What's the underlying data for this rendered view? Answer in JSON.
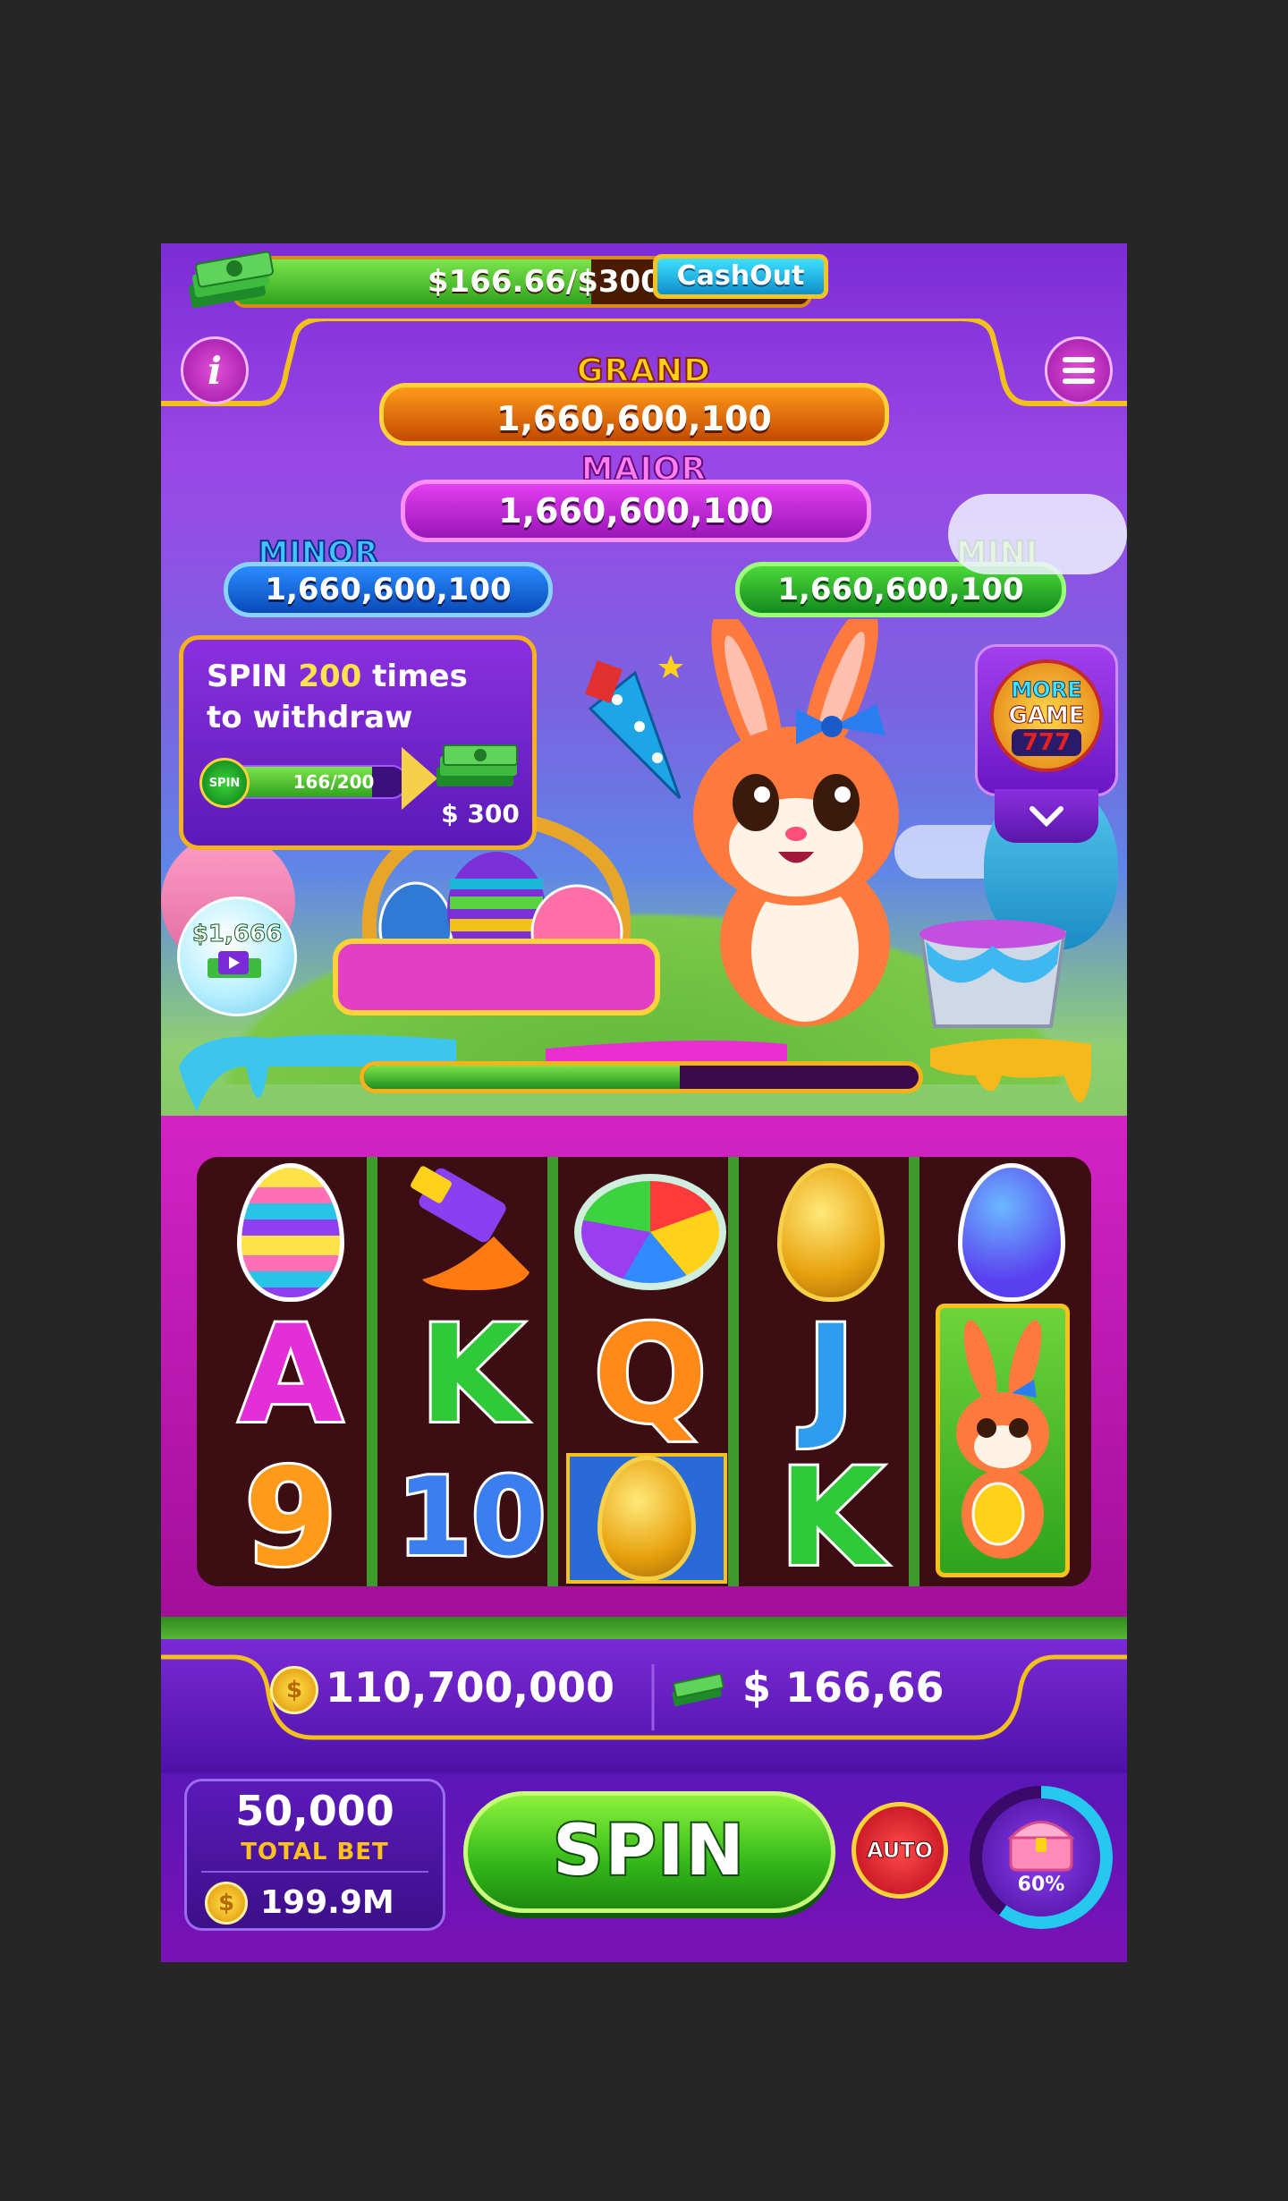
{
  "top_bar": {
    "cash_progress": "$166.66/$300.00",
    "cashout_label": "CashOut"
  },
  "jackpots": {
    "grand": {
      "label": "GRAND",
      "value": "1,660,600,100"
    },
    "major": {
      "label": "MAJOR",
      "value": "1,660,600,100"
    },
    "minor": {
      "label": "MINOR",
      "value": "1,660,600,100"
    },
    "mini": {
      "label": "MINI",
      "value": "1,660,600,100"
    }
  },
  "withdraw_panel": {
    "line1_prefix": "SPIN ",
    "line1_count": "200",
    "line1_suffix": " times",
    "line2": "to withdraw",
    "spin_badge": "SPIN",
    "progress_text": "166/200",
    "progress_fraction": 0.83,
    "reward": "$ 300"
  },
  "more_game": {
    "line1": "MORE",
    "line2": "GAME",
    "line3": "777"
  },
  "video_bonus": {
    "amount": "$1,666"
  },
  "level_progress_fraction": 0.57,
  "reels": [
    [
      "egg-striped",
      "paint-tube",
      "paint-palette",
      "egg-gold",
      "egg-starry"
    ],
    [
      "A",
      "K",
      "Q",
      "J",
      "bunny-wild"
    ],
    [
      "9",
      "10",
      "golden-eggs",
      "K",
      "bunny-wild"
    ]
  ],
  "balance": {
    "coins": "110,700,000",
    "cash": "$ 166,66"
  },
  "bet": {
    "amount": "50,000",
    "label": "TOTAL BET",
    "coin_total": "199.9M"
  },
  "controls": {
    "spin_label": "SPIN",
    "auto_label": "AUTO",
    "chest_percent": "60%",
    "chest_fraction": 0.6
  },
  "colors": {
    "grand": "#ff8a00",
    "major": "#c52dd8",
    "minor": "#1b74ea",
    "mini": "#26b72b",
    "spin_green": "#4bd824",
    "cashout_blue": "#19b5e6"
  }
}
